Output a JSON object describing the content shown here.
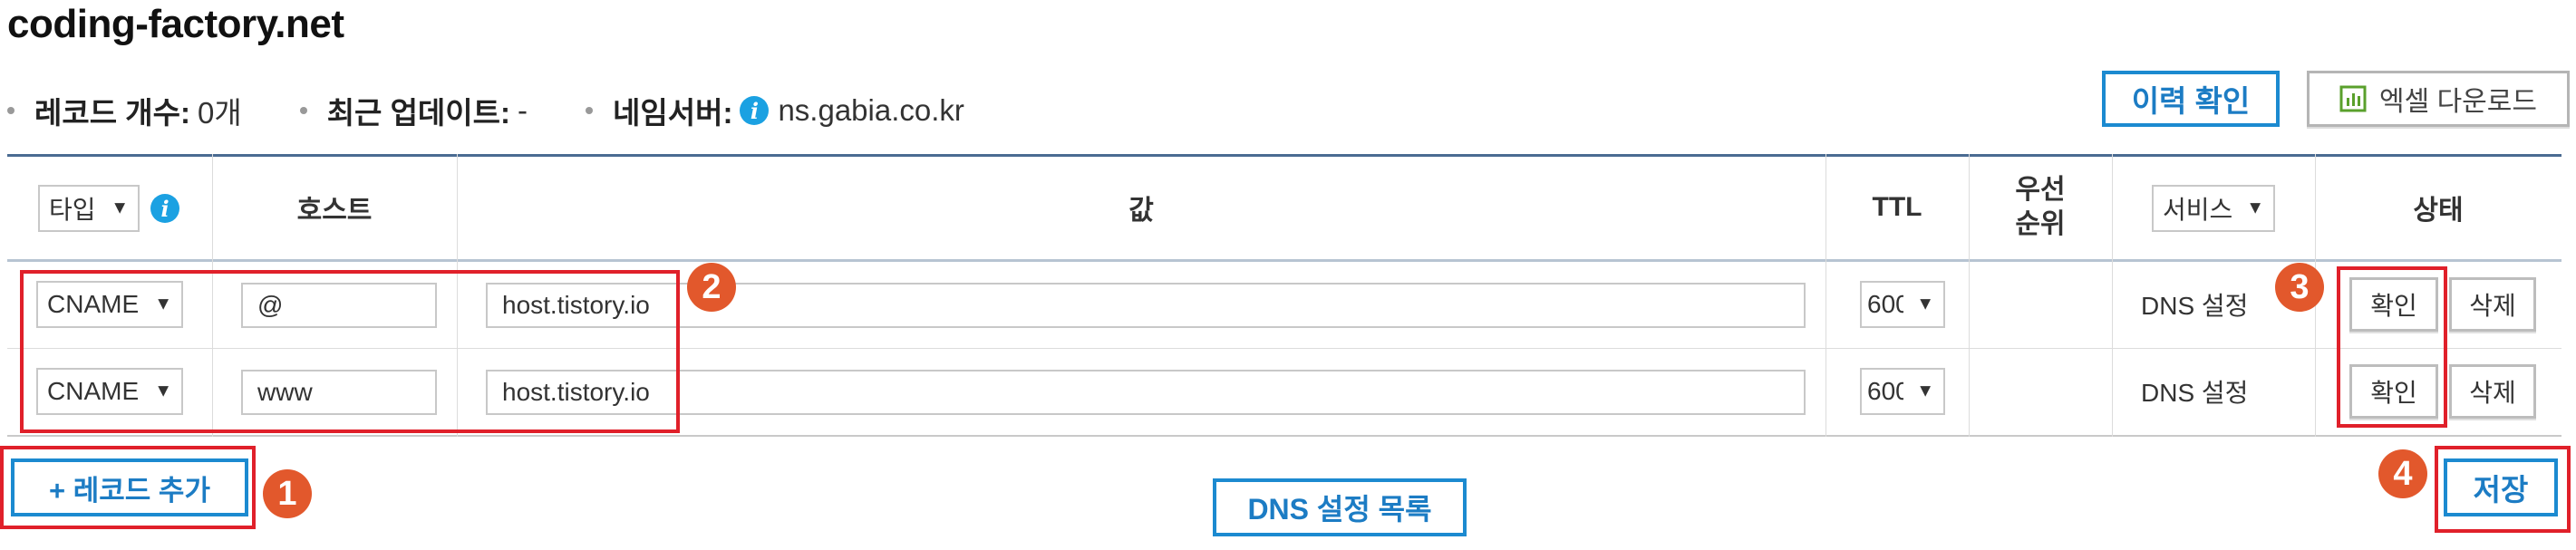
{
  "domain": "coding-factory.net",
  "summary": {
    "record_count_label": "레코드 개수:",
    "record_count_value": "0개",
    "last_update_label": "최근 업데이트:",
    "last_update_value": "-",
    "nameserver_label": "네임서버:",
    "nameserver_value": "ns.gabia.co.kr"
  },
  "toolbar": {
    "history_label": "이력 확인",
    "excel_label": "엑셀 다운로드"
  },
  "table": {
    "headers": {
      "type_select": "타입",
      "host": "호스트",
      "value": "값",
      "ttl": "TTL",
      "priority_line1": "우선",
      "priority_line2": "순위",
      "service_select": "서비스",
      "status": "상태"
    },
    "rows": [
      {
        "type": "CNAME",
        "host": "@",
        "value": "host.tistory.io",
        "ttl": "600",
        "priority": "",
        "service": "DNS 설정",
        "confirm": "확인",
        "delete": "삭제"
      },
      {
        "type": "CNAME",
        "host": "www",
        "value": "host.tistory.io",
        "ttl": "600",
        "priority": "",
        "service": "DNS 설정",
        "confirm": "확인",
        "delete": "삭제"
      }
    ]
  },
  "actions": {
    "add_record_label": "+ 레코드 추가",
    "dns_list_label": "DNS 설정 목록",
    "save_label": "저장"
  },
  "annotations": [
    "1",
    "2",
    "3",
    "4"
  ],
  "colors": {
    "accent_blue": "#1c8ad0",
    "annotation_red": "#e0202a",
    "badge_orange": "#e2582c",
    "info_blue": "#1ba1e2"
  }
}
